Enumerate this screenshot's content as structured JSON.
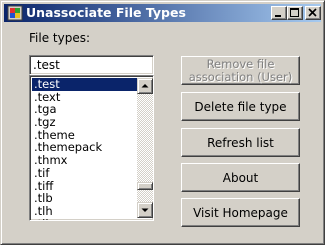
{
  "window": {
    "title": "Unassociate File Types",
    "icon": "app-icon"
  },
  "main": {
    "file_types_label": "File types:",
    "filter_value": ".test",
    "list_items": [
      ".test",
      ".text",
      ".tga",
      ".tgz",
      ".theme",
      ".themepack",
      ".thmx",
      ".tif",
      ".tiff",
      ".tlb",
      ".tlh",
      ".tli"
    ],
    "selected_item": ".test"
  },
  "buttons": {
    "remove_association": "Remove file association (User)",
    "delete_file_type": "Delete file type",
    "refresh_list": "Refresh list",
    "about": "About",
    "visit_homepage": "Visit Homepage"
  },
  "colors": {
    "title_gradient_start": "#0a246a",
    "title_gradient_end": "#a6caf0",
    "selection": "#0a246a",
    "face": "#d4d0c8"
  }
}
